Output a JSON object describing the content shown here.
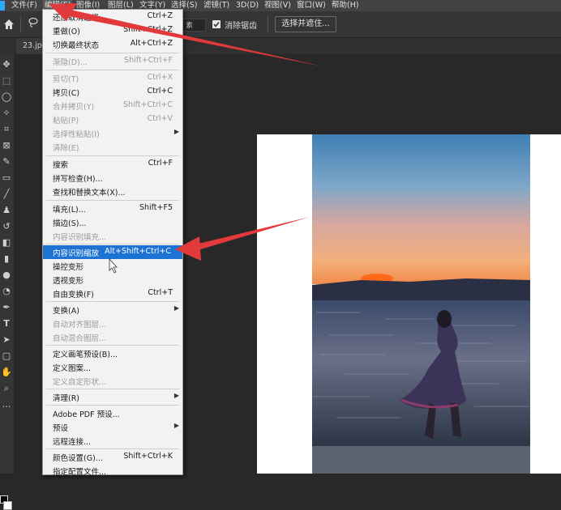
{
  "menubar": [
    {
      "label": "文件(F)"
    },
    {
      "label": "编辑(E)"
    },
    {
      "label": "图像(I)"
    },
    {
      "label": "图层(L)"
    },
    {
      "label": "文字(Y)"
    },
    {
      "label": "选择(S)"
    },
    {
      "label": "滤镜(T)"
    },
    {
      "label": "3D(D)"
    },
    {
      "label": "视图(V)"
    },
    {
      "label": "窗口(W)"
    },
    {
      "label": "帮助(H)"
    }
  ],
  "options": {
    "field_text": "素",
    "antialias_label": "消除锯齿",
    "select_mask_button": "选择并遮住..."
  },
  "tab": {
    "label": "23.jp"
  },
  "edit_menu": [
    {
      "label": "还原取消选择",
      "shortcut": "Ctrl+Z"
    },
    {
      "label": "重做(O)",
      "shortcut": "Shift+Ctrl+Z"
    },
    {
      "label": "切换最终状态",
      "shortcut": "Alt+Ctrl+Z"
    },
    {
      "label": "渐隐(D)...",
      "shortcut": "Shift+Ctrl+F"
    },
    {
      "label": "剪切(T)",
      "shortcut": "Ctrl+X"
    },
    {
      "label": "拷贝(C)",
      "shortcut": "Ctrl+C"
    },
    {
      "label": "合并拷贝(Y)",
      "shortcut": "Shift+Ctrl+C"
    },
    {
      "label": "粘贴(P)",
      "shortcut": "Ctrl+V"
    },
    {
      "label": "选择性粘贴(I)",
      "shortcut": ""
    },
    {
      "label": "清除(E)",
      "shortcut": ""
    },
    {
      "label": "搜索",
      "shortcut": "Ctrl+F"
    },
    {
      "label": "拼写检查(H)...",
      "shortcut": ""
    },
    {
      "label": "查找和替换文本(X)...",
      "shortcut": ""
    },
    {
      "label": "填充(L)...",
      "shortcut": "Shift+F5"
    },
    {
      "label": "描边(S)...",
      "shortcut": ""
    },
    {
      "label": "内容识别填充...",
      "shortcut": ""
    },
    {
      "label": "内容识别缩放",
      "shortcut": "Alt+Shift+Ctrl+C"
    },
    {
      "label": "操控变形",
      "shortcut": ""
    },
    {
      "label": "透视变形",
      "shortcut": ""
    },
    {
      "label": "自由变换(F)",
      "shortcut": "Ctrl+T"
    },
    {
      "label": "变换(A)",
      "shortcut": ""
    },
    {
      "label": "自动对齐图层...",
      "shortcut": ""
    },
    {
      "label": "自动混合图层...",
      "shortcut": ""
    },
    {
      "label": "定义画笔预设(B)...",
      "shortcut": ""
    },
    {
      "label": "定义图案...",
      "shortcut": ""
    },
    {
      "label": "定义自定形状...",
      "shortcut": ""
    },
    {
      "label": "清理(R)",
      "shortcut": ""
    },
    {
      "label": "Adobe PDF 预设...",
      "shortcut": ""
    },
    {
      "label": "预设",
      "shortcut": ""
    },
    {
      "label": "远程连接...",
      "shortcut": ""
    },
    {
      "label": "颜色设置(G)...",
      "shortcut": "Shift+Ctrl+K"
    },
    {
      "label": "指定配置文件...",
      "shortcut": ""
    }
  ],
  "colors": {
    "menu_highlight": "#1d73d4",
    "arrow_red": "#e23a3a",
    "ui_dark": "#353535"
  }
}
